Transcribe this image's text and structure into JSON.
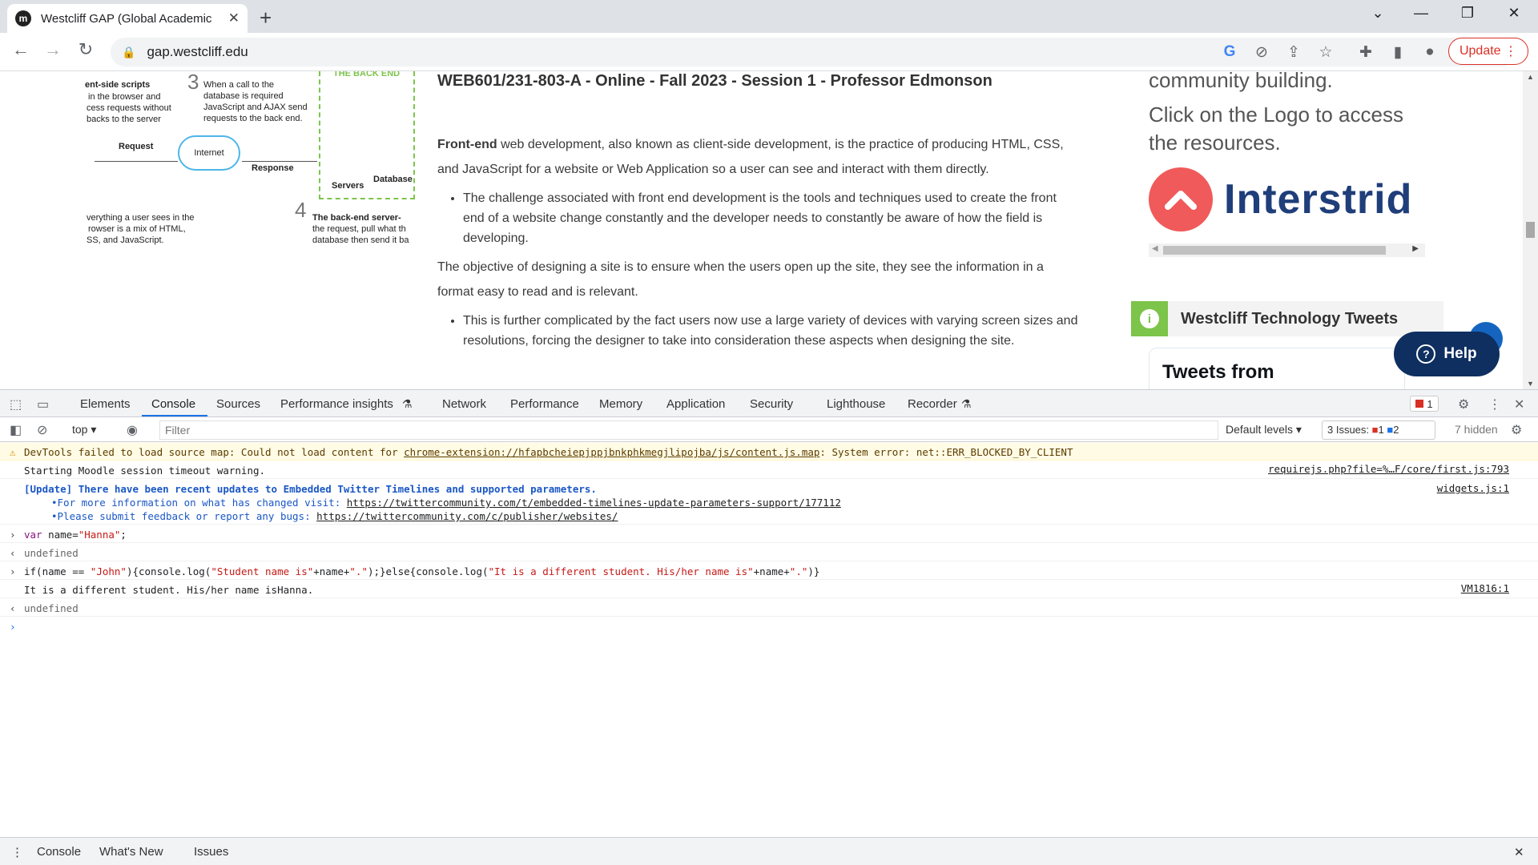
{
  "browser": {
    "tab_title": "Westcliff GAP (Global Academic P",
    "favicon_letter": "m",
    "url": "gap.westcliff.edu",
    "update_label": "Update"
  },
  "page": {
    "diagram": {
      "client_title": "ent-side scripts",
      "client_text_1": "in the browser and",
      "client_text_2": "cess requests without",
      "client_text_3": "backs to the server",
      "step3_num": "3",
      "step3_text_1": "When a call to the",
      "step3_text_2": "database is required",
      "step3_text_3": "JavaScript and AJAX send",
      "step3_text_4": "requests to the back end.",
      "backend_label": "THE BACK END",
      "request_label": "Request",
      "internet_label": "Internet",
      "response_label": "Response",
      "servers_label": "Servers",
      "database_label": "Database",
      "bottom_text_1": "verything a user sees in the",
      "bottom_text_2": "rowser is a mix of HTML,",
      "bottom_text_3": "SS, and JavaScript.",
      "step4_num": "4",
      "step4_title": "The back-end server-",
      "step4_text_1": "the request, pull what th",
      "step4_text_2": "database then send it ba"
    },
    "article": {
      "heading": "WEB601/231-803-A - Online - Fall 2023 - Session 1 - Professor Edmonson",
      "p1_bold": "Front-end",
      "p1_rest": " web development, also known as client-side development, is the practice of producing HTML, CSS, and JavaScript for a website or Web Application so a user can see and interact with them directly.",
      "bullet1": "The challenge associated with front end development is the tools and techniques used to create the front end of a website change constantly and the developer needs to constantly be aware of how the field is developing.",
      "p2": "The objective of designing a site is to ensure when the users open up the site, they see the information in a format easy to read and is relevant.",
      "bullet2": "This is further complicated by the fact users now use a large variety of devices with varying screen sizes and resolutions, forcing the designer to take into consideration these aspects when designing the site."
    },
    "sidebar": {
      "line1": "community building.",
      "line2": "Click on the Logo to access",
      "line3": "the resources.",
      "logo_name": "Interstrid",
      "tweets_heading": "Westcliff Technology Tweets",
      "tweets_from": "Tweets from",
      "help_label": "Help"
    }
  },
  "devtools": {
    "tabs": [
      "Elements",
      "Console",
      "Sources",
      "Performance insights",
      "Network",
      "Performance",
      "Memory",
      "Application",
      "Security",
      "Lighthouse",
      "Recorder"
    ],
    "error_count": "1",
    "context": "top",
    "filter_placeholder": "Filter",
    "levels": "Default levels",
    "issues_label": "3 Issues:",
    "issues_errors": "1",
    "issues_info": "2",
    "hidden": "7 hidden",
    "console": {
      "warn_prefix": "DevTools failed to load source map: Could not load content for ",
      "warn_link": "chrome-extension://hfapbcheiepjppjbnkphkmegjlipojba/js/content.js.map",
      "warn_suffix": ": System error: net::ERR_BLOCKED_BY_CLIENT",
      "log1": "Starting Moodle session timeout warning.",
      "log1_src": "requirejs.php?file=%…F/core/first.js:793",
      "log2_title": "[Update] There have been recent updates to Embedded Twitter Timelines and supported parameters.",
      "log2_line2_prefix": "•For more information on what has changed visit: ",
      "log2_line2_link": "https://twittercommunity.com/t/embedded-timelines-update-parameters-support/177112",
      "log2_line3_prefix": "•Please submit feedback or report any bugs: ",
      "log2_line3_link": "https://twittercommunity.com/c/publisher/websites/",
      "log2_src": "widgets.js:1",
      "input1_kw": "var",
      "input1_rest": " name=",
      "input1_str": "\"Hanna\"",
      "input1_end": ";",
      "result1": "undefined",
      "input2_a": "if(name == ",
      "input2_s1": "\"John\"",
      "input2_b": "){console.log(",
      "input2_s2": "\"Student name is\"",
      "input2_c": "+name+",
      "input2_s3": "\".\"",
      "input2_d": ");}else{console.log(",
      "input2_s4": "\"It is a different student. His/her name is\"",
      "input2_e": "+name+",
      "input2_s5": "\".\"",
      "input2_f": ")}",
      "output2": "It is a different student. His/her name isHanna.",
      "output2_src": "VM1816:1",
      "result2": "undefined"
    },
    "drawer_tabs": [
      "Console",
      "What's New",
      "Issues"
    ]
  }
}
